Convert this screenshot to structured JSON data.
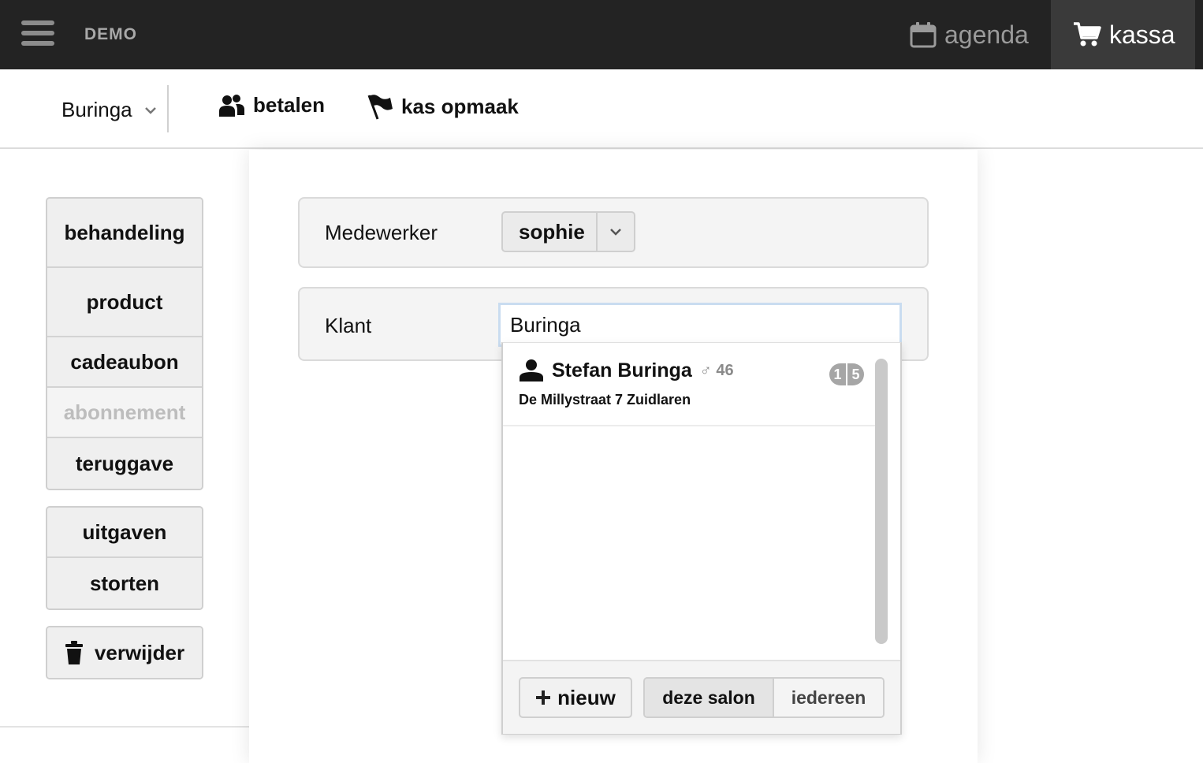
{
  "header": {
    "brand": "DEMO",
    "nav": [
      {
        "label": "agenda",
        "icon": "calendar-icon"
      },
      {
        "label": "kassa",
        "icon": "cart-icon",
        "active": true
      }
    ]
  },
  "subnav": {
    "salon": "Buringa",
    "links": [
      {
        "label": "betalen",
        "icon": "users-icon"
      },
      {
        "label": "kas opmaak",
        "icon": "flag-icon"
      }
    ]
  },
  "sidebar": {
    "group1": [
      {
        "label": "behandeling",
        "disabled": false
      },
      {
        "label": "product",
        "disabled": false
      },
      {
        "label": "cadeaubon",
        "disabled": false
      },
      {
        "label": "abonnement",
        "disabled": true
      },
      {
        "label": "teruggave",
        "disabled": false
      }
    ],
    "group2": [
      {
        "label": "uitgaven"
      },
      {
        "label": "storten"
      }
    ],
    "delete_label": "verwijder"
  },
  "form": {
    "medewerker_label": "Medewerker",
    "medewerker_value": "sophie",
    "klant_label": "Klant",
    "klant_value": "Buringa"
  },
  "dropdown": {
    "results": [
      {
        "name": "Stefan Buringa",
        "gender_symbol": "♂",
        "age": "46",
        "address": "De Millystraat 7 Zuidlaren",
        "badges": [
          "1",
          "5"
        ]
      }
    ],
    "new_label": "nieuw",
    "scope_options": [
      "deze salon",
      "iedereen"
    ],
    "scope_selected": "deze salon"
  },
  "colors": {
    "topbar": "#232323",
    "active_nav": "#3a3a3a",
    "disabled_text": "#bdbdbd",
    "badge": "#a6a6a6"
  }
}
